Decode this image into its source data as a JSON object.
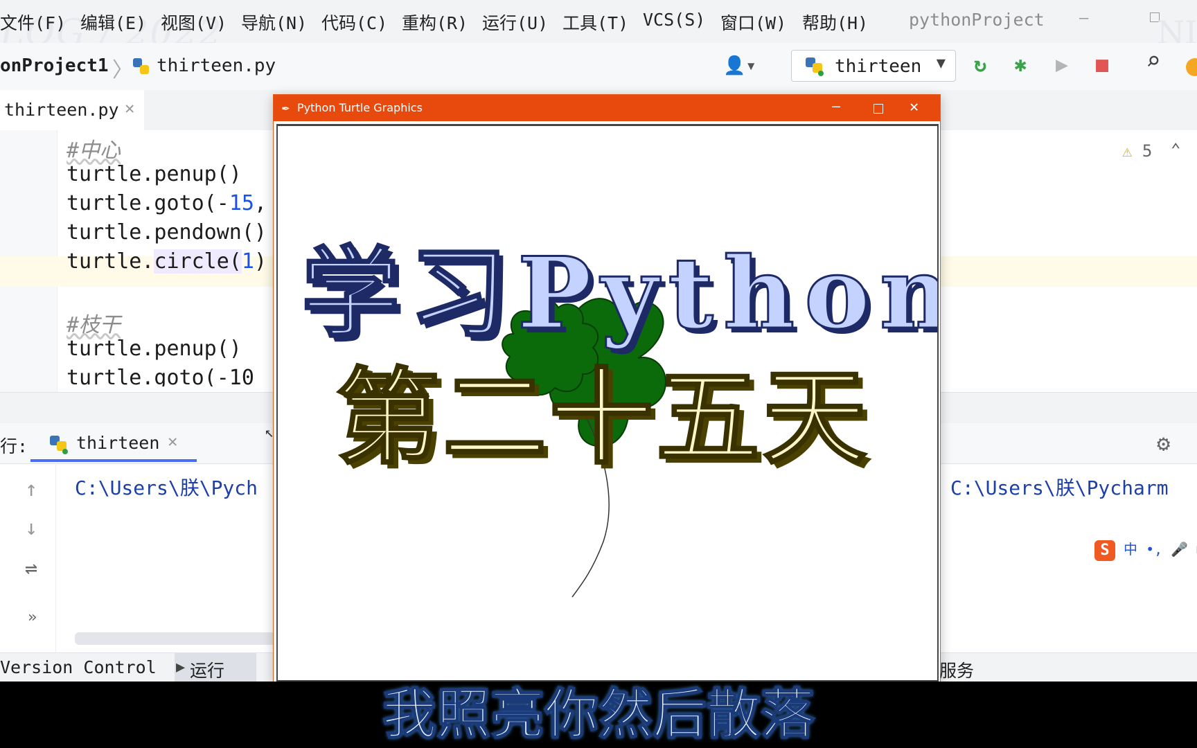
{
  "menu": {
    "items": [
      "文件(F)",
      "编辑(E)",
      "视图(V)",
      "导航(N)",
      "代码(C)",
      "重构(R)",
      "运行(U)",
      "工具(T)",
      "VCS(S)",
      "窗口(W)",
      "帮助(H)"
    ],
    "window_title": "pythonProject",
    "min_glyph": "–"
  },
  "watermarks": {
    "left": "LOG / 2022",
    "right": "NI"
  },
  "nav": {
    "project": "onProject1",
    "separator": "〉",
    "file": "thirteen.py",
    "run_config": "thirteen",
    "user_glyph": "👤▾",
    "caret_glyph": "▼"
  },
  "toolbar": {
    "rerun": "↻",
    "debug": "✱",
    "coverage": "▶",
    "stop": "■",
    "search": "⌕"
  },
  "editor": {
    "tab_label": "thirteen.py",
    "tab_close": "✕",
    "warnings_count": "5",
    "warn_glyph": "⚠",
    "collapse_glyph": "⌃",
    "lines": [
      {
        "comment": "#中心"
      },
      {
        "pre": "turtle.penup()"
      },
      {
        "pre": "turtle.goto(-",
        "num": "15",
        "post": ","
      },
      {
        "pre": "turtle.pendown()"
      },
      {
        "pre": "turtle.",
        "call": "circle(",
        "num": "1",
        "post": ")"
      },
      {
        "pre": ""
      },
      {
        "comment": "#枝干"
      },
      {
        "pre": "turtle.penup()"
      },
      {
        "pre": "turtle.goto(-10"
      }
    ]
  },
  "run_panel": {
    "label": "行:",
    "tab_label": "thirteen",
    "tab_close": "✕",
    "settings_glyph": "⚙",
    "console_left": "C:\\Users\\朕\\Pych",
    "console_right": "C:\\Users\\朕\\Pycharm",
    "up_glyph": "↑",
    "down_glyph": "↓",
    "wrap_glyph": "⇌",
    "more_glyph": "»",
    "ime_logo": "S",
    "ime_text": "中 •, 🎤 ⊞"
  },
  "status": {
    "version_control": "Version Control",
    "run_label": "运行",
    "services": "服务"
  },
  "turtle_window": {
    "title": "Python Turtle Graphics",
    "feather_glyph": "✒",
    "min_glyph": "–",
    "close_glyph": "✕",
    "line1": "学习Python",
    "line2": "第二十五天",
    "clover_color": "#0b6b0b",
    "line1_color": "#c3d2ff",
    "line2_color": "#fdf6c8"
  },
  "subtitle": "我照亮你然后散落",
  "colors": {
    "accent": "#4a6cf7",
    "turtle_titlebar": "#e8490c",
    "stop_red": "#e05555",
    "run_green": "#3aa34a"
  }
}
